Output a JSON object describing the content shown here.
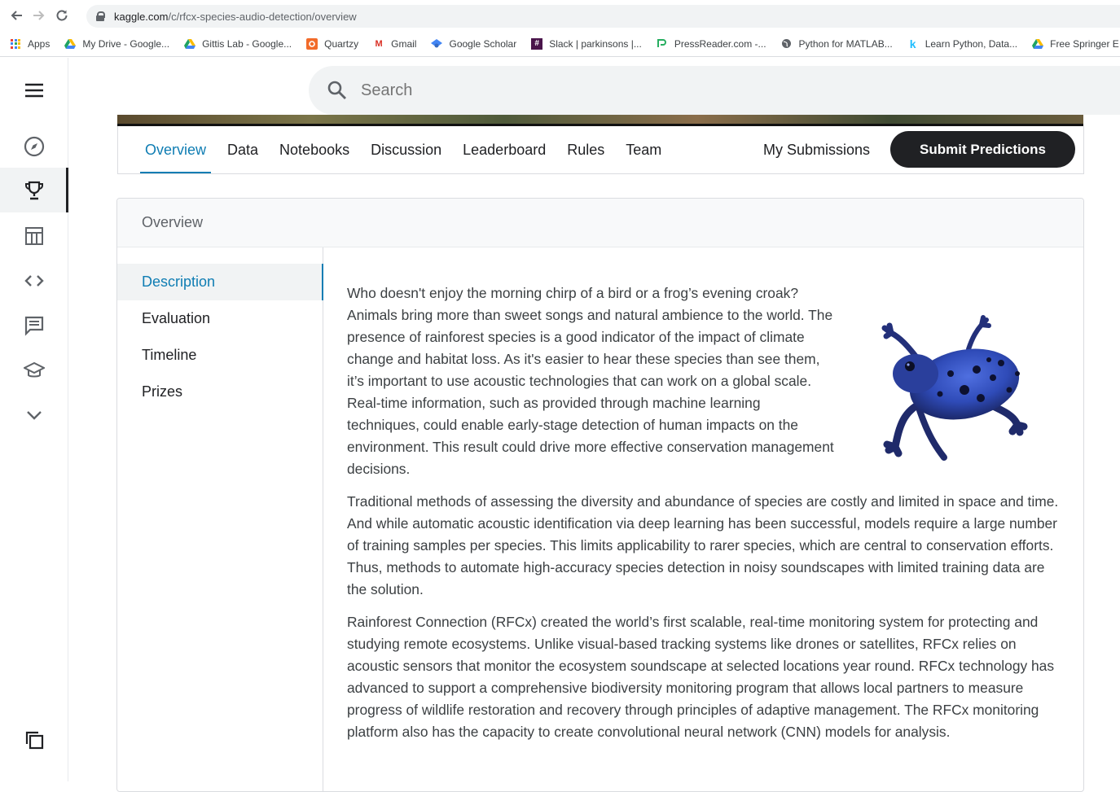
{
  "browser": {
    "url_host": "kaggle.com",
    "url_path": "/c/rfcx-species-audio-detection/overview",
    "bookmarks": [
      {
        "label": "Apps",
        "icon": "apps-grid-icon"
      },
      {
        "label": "My Drive - Google...",
        "icon": "google-drive-icon"
      },
      {
        "label": "Gittis Lab - Google...",
        "icon": "google-drive-icon"
      },
      {
        "label": "Quartzy",
        "icon": "quartzy-icon"
      },
      {
        "label": "Gmail",
        "icon": "gmail-icon"
      },
      {
        "label": "Google Scholar",
        "icon": "scholar-icon"
      },
      {
        "label": "Slack | parkinsons |...",
        "icon": "slack-icon"
      },
      {
        "label": "PressReader.com -...",
        "icon": "pressreader-icon"
      },
      {
        "label": "Python for MATLAB...",
        "icon": "globe-icon"
      },
      {
        "label": "Learn Python, Data...",
        "icon": "kaggle-k-icon"
      },
      {
        "label": "Free Springer E",
        "icon": "google-drive-icon"
      }
    ]
  },
  "search": {
    "placeholder": "Search"
  },
  "tabs": [
    {
      "label": "Overview",
      "active": true
    },
    {
      "label": "Data"
    },
    {
      "label": "Notebooks"
    },
    {
      "label": "Discussion"
    },
    {
      "label": "Leaderboard"
    },
    {
      "label": "Rules"
    },
    {
      "label": "Team"
    }
  ],
  "my_submissions": "My Submissions",
  "submit_button": "Submit Predictions",
  "overview": {
    "title": "Overview",
    "side_nav": [
      "Description",
      "Evaluation",
      "Timeline",
      "Prizes"
    ],
    "paragraphs": [
      "Who doesn't enjoy the morning chirp of a bird or a frog’s evening croak? Animals bring more than sweet songs and natural ambience to the world. The presence of rainforest species is a good indicator of the impact of climate change and habitat loss. As it's easier to hear these species than see them, it’s important to use acoustic technologies that can work on a global scale. Real-time information, such as provided through machine learning techniques, could enable early-stage detection of human impacts on the environment. This result could drive more effective conservation management decisions.",
      "Traditional methods of assessing the diversity and abundance of species are costly and limited in space and time. And while automatic acoustic identification via deep learning has been successful, models require a large number of training samples per species. This limits applicability to rarer species, which are central to conservation efforts. Thus, methods to automate high-accuracy species detection in noisy soundscapes with limited training data are the solution.",
      "Rainforest Connection (RFCx) created the world’s first scalable, real-time monitoring system for protecting and studying remote ecosystems. Unlike visual-based tracking systems like drones or satellites, RFCx relies on acoustic sensors that monitor the ecosystem soundscape at selected locations year round. RFCx technology has advanced to support a comprehensive biodiversity monitoring program that allows local partners to measure progress of wildlife restoration and recovery through principles of adaptive management. The RFCx monitoring platform also has the capacity to create convolutional neural network (CNN) models for analysis."
    ]
  },
  "colors": {
    "accent": "#0f7db3",
    "dark": "#202124",
    "frog": "#2f4bb8"
  }
}
